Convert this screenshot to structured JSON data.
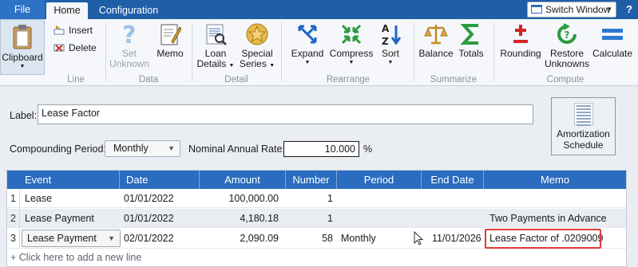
{
  "tabs": {
    "file": "File",
    "home": "Home",
    "configuration": "Configuration"
  },
  "switch_window": "Switch Window",
  "help": "?",
  "ribbon": {
    "clipboard": "Clipboard",
    "insert": "Insert",
    "delete": "Delete",
    "set_unknown_1": "Set",
    "set_unknown_2": "Unknown",
    "memo": "Memo",
    "loan_details_1": "Loan",
    "loan_details_2": "Details",
    "special_series_1": "Special",
    "special_series_2": "Series",
    "expand": "Expand",
    "compress": "Compress",
    "sort": "Sort",
    "balance": "Balance",
    "totals": "Totals",
    "rounding": "Rounding",
    "restore_unknowns_1": "Restore",
    "restore_unknowns_2": "Unknowns",
    "calculate": "Calculate",
    "groups": {
      "line": "Line",
      "data": "Data",
      "detail": "Detail",
      "rearrange": "Rearrange",
      "summarize": "Summarize",
      "compute": "Compute"
    }
  },
  "form": {
    "label_label": "Label:",
    "label_value": "Lease Factor",
    "compounding_label": "Compounding Period:",
    "compounding_value": "Monthly",
    "nominal_label": "Nominal Annual Rate:",
    "nominal_value": "10.000",
    "percent": "%",
    "amortization_1": "Amortization",
    "amortization_2": "Schedule"
  },
  "grid": {
    "columns": [
      "Event",
      "Date",
      "Amount",
      "Number",
      "Period",
      "End Date",
      "Memo"
    ],
    "rows": [
      {
        "n": "1",
        "event": "Lease",
        "date": "01/01/2022",
        "amount": "100,000.00",
        "number": "1",
        "period": "",
        "end_date": "",
        "memo": ""
      },
      {
        "n": "2",
        "event": "Lease Payment",
        "date": "01/01/2022",
        "amount": "4,180.18",
        "number": "1",
        "period": "",
        "end_date": "",
        "memo": "Two Payments in Advance"
      },
      {
        "n": "3",
        "event": "Lease Payment",
        "date": "02/01/2022",
        "amount": "2,090.09",
        "number": "58",
        "period": "Monthly",
        "end_date": "11/01/2026",
        "memo": "Lease Factor of .0209009"
      }
    ],
    "add_line": "+ Click here to add a new line"
  },
  "colors": {
    "ribbon_blue": "#1f5fa8",
    "header_blue": "#2a6cbf",
    "highlight_red": "#e03a3a"
  }
}
